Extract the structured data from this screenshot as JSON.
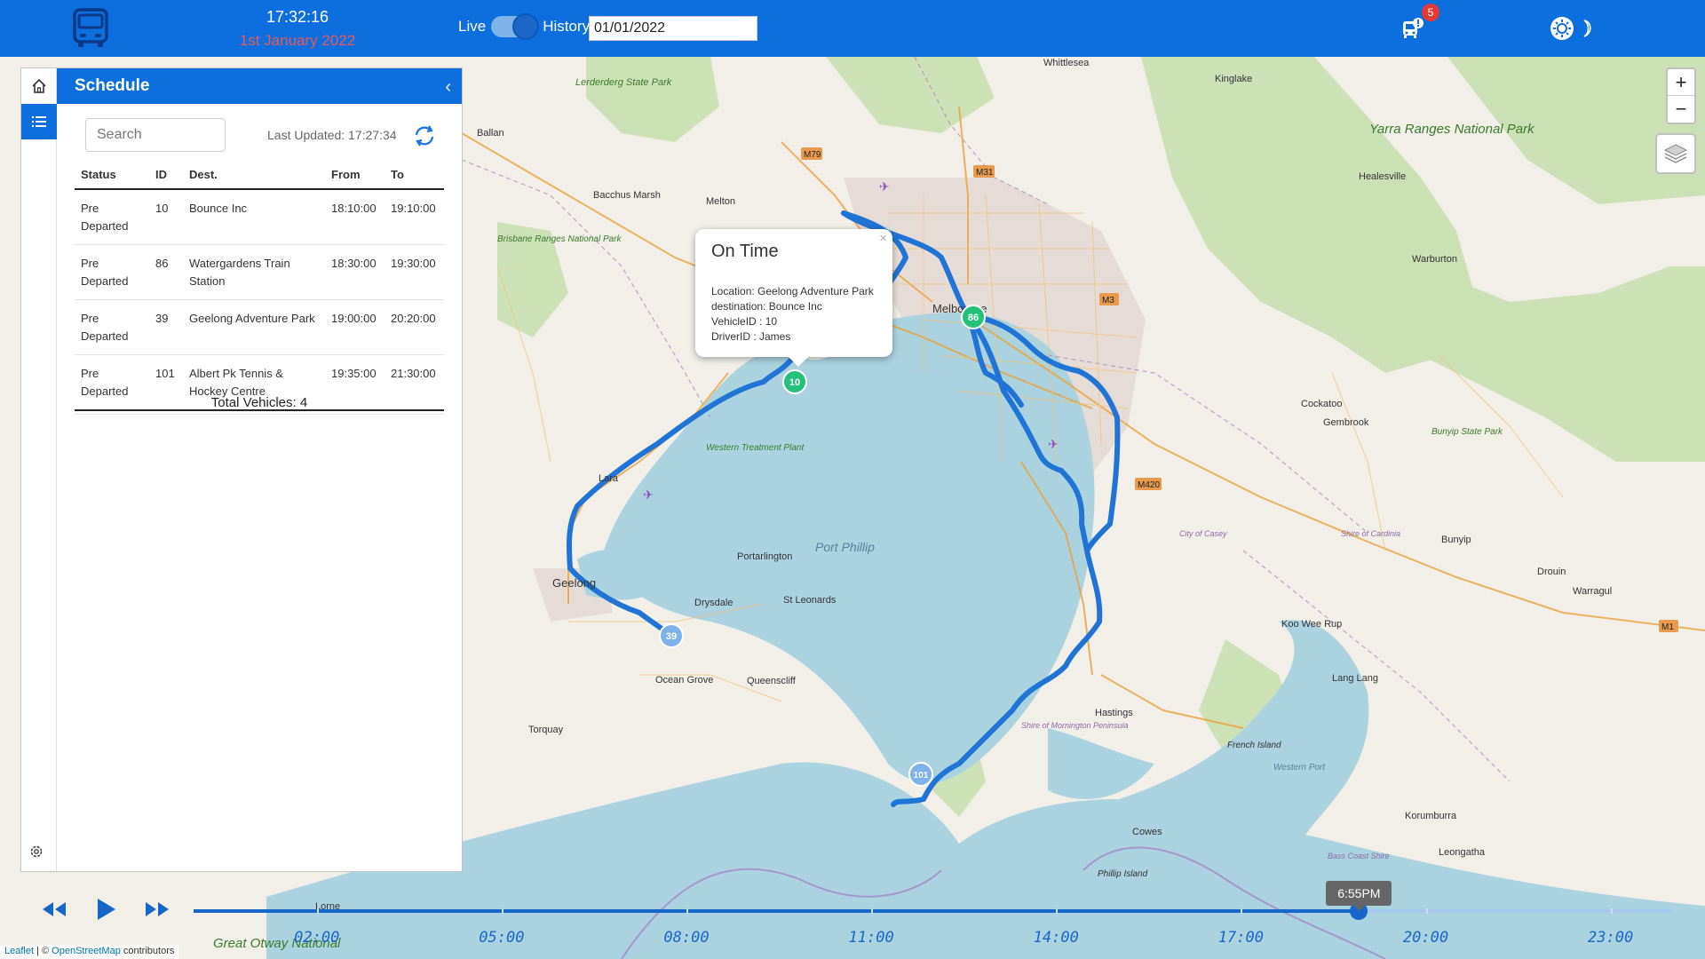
{
  "header": {
    "time": "17:32:16",
    "date": "1st January 2022",
    "live_label": "Live",
    "history_label": "History",
    "history_date": "01/01/2022",
    "notification_count": "5"
  },
  "panel": {
    "title": "Schedule",
    "search_placeholder": "Search",
    "last_updated": "Last Updated: 17:27:34",
    "columns": [
      "Status",
      "ID",
      "Dest.",
      "From",
      "To"
    ],
    "rows": [
      {
        "status": "Pre Departed",
        "id": "10",
        "dest": "Bounce Inc",
        "from": "18:10:00",
        "to": "19:10:00"
      },
      {
        "status": "Pre Departed",
        "id": "86",
        "dest": "Watergardens Train Station",
        "from": "18:30:00",
        "to": "19:30:00"
      },
      {
        "status": "Pre Departed",
        "id": "39",
        "dest": "Geelong Adventure Park",
        "from": "19:00:00",
        "to": "20:20:00"
      },
      {
        "status": "Pre Departed",
        "id": "101",
        "dest": "Albert Pk Tennis & Hockey Centre",
        "from": "19:35:00",
        "to": "21:30:00"
      }
    ],
    "total": "Total Vehicles: 4"
  },
  "popup": {
    "status": "On Time",
    "location": "Location: Geelong Adventure Park",
    "destination": "destination: Bounce Inc",
    "vehicle": "VehicleID : 10",
    "driver": "DriverID : James"
  },
  "markers": [
    {
      "id": "10",
      "color": "#22c27a"
    },
    {
      "id": "86",
      "color": "#22c27a"
    },
    {
      "id": "39",
      "color": "#7db2ea"
    },
    {
      "id": "101",
      "color": "#7db2ea"
    }
  ],
  "map_labels": {
    "whittlesea": "Whittlesea",
    "kinglake": "Kinglake",
    "lerderderg": "Lerderderg State Park",
    "yarra": "Yarra Ranges National Park",
    "ballan": "Ballan",
    "bacchus": "Bacchus Marsh",
    "melton": "Melton",
    "melbourne": "Melbourne",
    "healesville": "Healesville",
    "warburton": "Warburton",
    "brisbane_ranges": "Brisbane Ranges National Park",
    "cockatoo": "Cockatoo",
    "gembrook": "Gembrook",
    "bunyip_sp": "Bunyip State Park",
    "lara": "Lara",
    "geelong": "Geelong",
    "port_phillip": "Port Phillip",
    "portarlington": "Portarlington",
    "drysdale": "Drysdale",
    "st_leonards": "St Leonards",
    "ocean_grove": "Ocean Grove",
    "queenscliff": "Queenscliff",
    "torquay": "Torquay",
    "hastings": "Hastings",
    "koo_wee_rup": "Koo Wee Rup",
    "bunyip": "Bunyip",
    "drouin": "Drouin",
    "warragul": "Warragul",
    "lang_lang": "Lang Lang",
    "french_island": "French Island",
    "western_port": "Western Port",
    "korumburra": "Korumburra",
    "leongatha": "Leongatha",
    "cowes": "Cowes",
    "phillip_island": "Phillip Island",
    "bass_coast": "Bass Coast Shire",
    "lorne": "Lorne",
    "great_otway": "Great Otway National",
    "mornington": "Shire of Mornington Peninsula",
    "western_treatment": "Western Treatment Plant",
    "city_of_casey": "City of Casey",
    "shire_cardinia": "Shire of Cardinia",
    "m79": "M79",
    "m31": "M31",
    "m3": "M3",
    "m420": "M420",
    "m1": "M1"
  },
  "timeline": {
    "current_label": "6:55PM",
    "progress": 0.7882,
    "ticks": [
      "02:00",
      "05:00",
      "08:00",
      "11:00",
      "14:00",
      "17:00",
      "20:00",
      "23:00"
    ]
  },
  "attribution": {
    "leaflet": "Leaflet",
    "sep": " | © ",
    "osm": "OpenStreetMap",
    "contrib": " contributors"
  }
}
